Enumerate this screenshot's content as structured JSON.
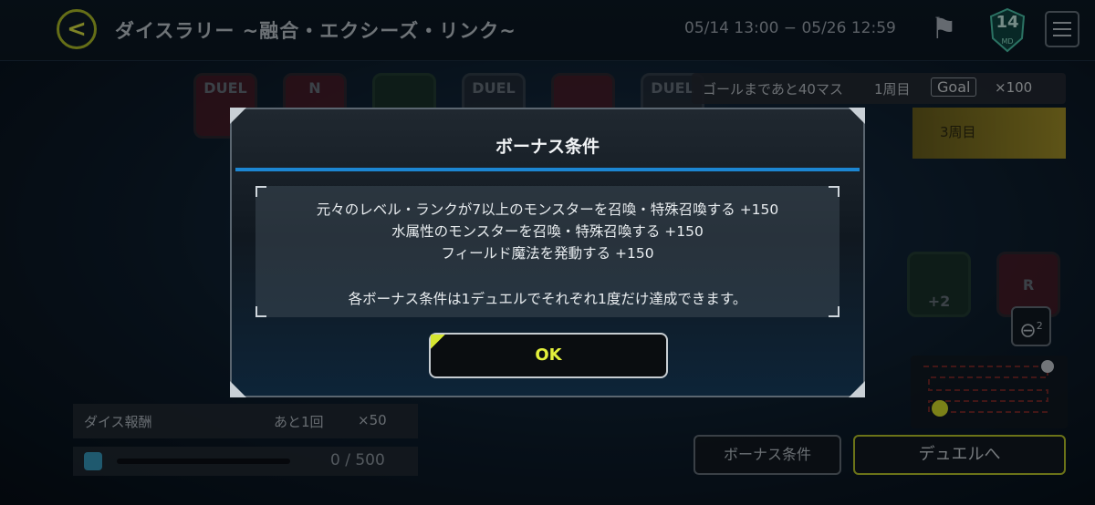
{
  "header": {
    "back_icon": "chevron-left-icon",
    "title": "ダイスラリー ~融合・エクシーズ・リンク~",
    "period": "05/14 13:00 − 05/26 12:59",
    "flag_icon": "flag-icon",
    "level_badge": {
      "value": "14",
      "label": "MD"
    },
    "menu_icon": "hamburger-icon"
  },
  "board": {
    "tiles": [
      "DUEL",
      "N",
      "",
      "DUEL",
      "",
      "DUEL",
      "R",
      "+2"
    ],
    "goal_banner": {
      "remaining": "ゴールまであと40マス",
      "lap": "1周目",
      "goal": "Goal",
      "reward": "×100"
    },
    "lap3": "3周目",
    "zoom_level": "2"
  },
  "dice_reward": {
    "label": "ダイス報酬",
    "remaining": "あと1回",
    "reward": "×50",
    "progress_text": "0 / 500",
    "progress_fraction": 0
  },
  "bottom_buttons": {
    "bonus": "ボーナス条件",
    "duel": "デュエルへ"
  },
  "modal": {
    "title": "ボーナス条件",
    "conditions": [
      "元々のレベル・ランクが7以上のモンスターを召喚・特殊召喚する +150",
      "水属性のモンスターを召喚・特殊召喚する +150",
      "フィールド魔法を発動する +150"
    ],
    "note": "各ボーナス条件は1デュエルでそれぞれ1度だけ達成できます。",
    "ok": "OK"
  },
  "colors": {
    "accent": "#d6e630",
    "modal_separator": "#1c86d2"
  }
}
